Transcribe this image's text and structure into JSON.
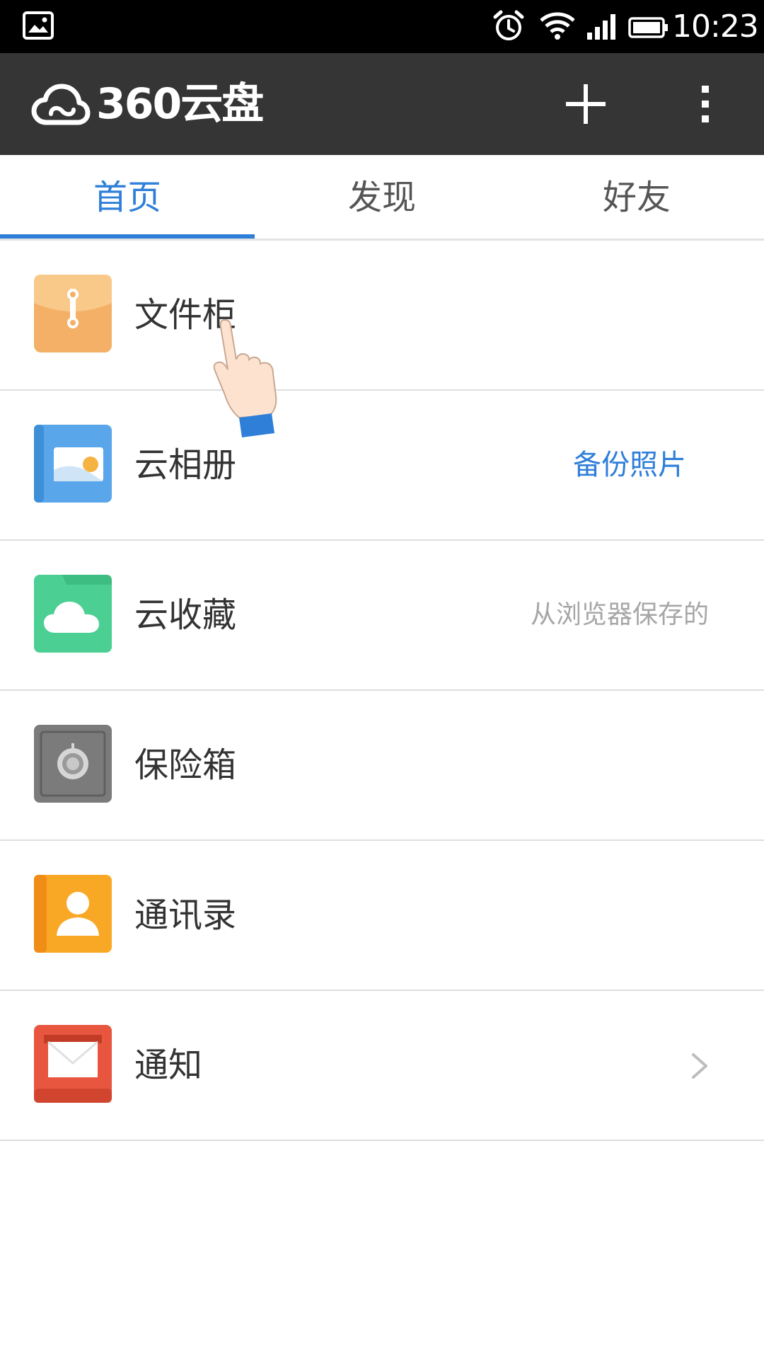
{
  "status_bar": {
    "time": "10:23",
    "icons": [
      "gallery-icon",
      "alarm-icon",
      "wifi-icon",
      "signal-icon",
      "battery-icon"
    ]
  },
  "title_bar": {
    "logo_text": "360云盘",
    "actions": [
      "add-icon",
      "more-vert-icon"
    ]
  },
  "tabs": [
    {
      "label": "首页",
      "active": true
    },
    {
      "label": "发现",
      "active": false
    },
    {
      "label": "好友",
      "active": false
    }
  ],
  "list": [
    {
      "label": "文件柜",
      "icon": "file-cabinet-icon"
    },
    {
      "label": "云相册",
      "icon": "cloud-album-icon",
      "action": "备份照片"
    },
    {
      "label": "云收藏",
      "icon": "cloud-favorites-icon",
      "hint": "从浏览器保存的"
    },
    {
      "label": "保险箱",
      "icon": "safe-icon"
    },
    {
      "label": "通讯录",
      "icon": "contacts-icon"
    },
    {
      "label": "通知",
      "icon": "notification-icon",
      "trailing": "chevron-right-icon"
    }
  ],
  "colors": {
    "accent": "#2f7fd9",
    "title_bar": "#353535",
    "status_bar": "#000000",
    "divider": "#dedede"
  }
}
